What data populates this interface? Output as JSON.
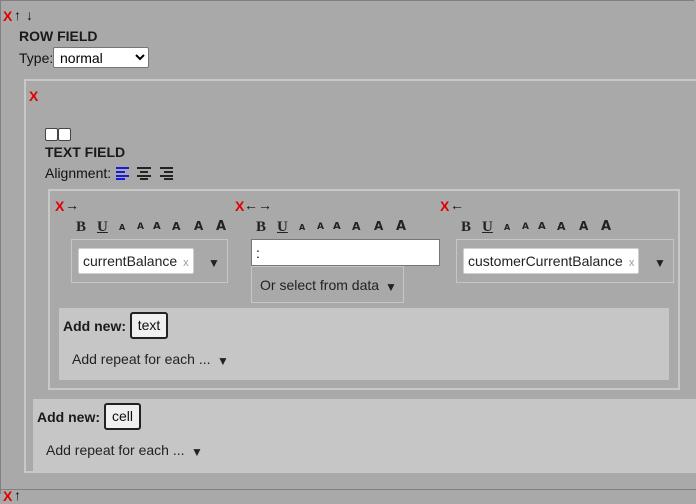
{
  "row_field": {
    "remove_label": "X",
    "move_up_icon": "arrow-up-icon",
    "move_down_icon": "arrow-down-icon",
    "title": "ROW FIELD",
    "type_label": "Type:",
    "type_value": "normal"
  },
  "text_field": {
    "remove_label": "X",
    "title": "TEXT FIELD",
    "alignment_label": "Alignment:",
    "alignment_icons": [
      "align-left-icon",
      "align-center-icon",
      "align-right-icon"
    ],
    "alignment_active_color": "#1a1adb"
  },
  "format_toolbar": {
    "bold": "B",
    "underline": "U",
    "sizes": [
      "A",
      "A",
      "A",
      "A",
      "A",
      "A"
    ]
  },
  "cells": [
    {
      "remove_label": "X",
      "arrows": [
        "arrow-right-icon"
      ],
      "chip_value": "currentBalance",
      "chip_remove": "x"
    },
    {
      "remove_label": "X",
      "arrows": [
        "arrow-left-icon",
        "arrow-right-icon"
      ],
      "input_value": ":",
      "select_label": "Or select from data"
    },
    {
      "remove_label": "X",
      "arrows": [
        "arrow-left-icon"
      ],
      "chip_value": "customerCurrentBalance",
      "chip_remove": "x"
    }
  ],
  "inner_add_new": {
    "label": "Add new:",
    "button": "text",
    "repeat_label": "Add repeat for each ..."
  },
  "outer_add_new": {
    "label": "Add new:",
    "button": "cell",
    "repeat_label": "Add repeat for each ..."
  },
  "next_row": {
    "remove_label": "X"
  },
  "colors": {
    "background": "#a9a9a9",
    "remove_red": "#e00000",
    "panel_border": "#c8c8c8"
  }
}
